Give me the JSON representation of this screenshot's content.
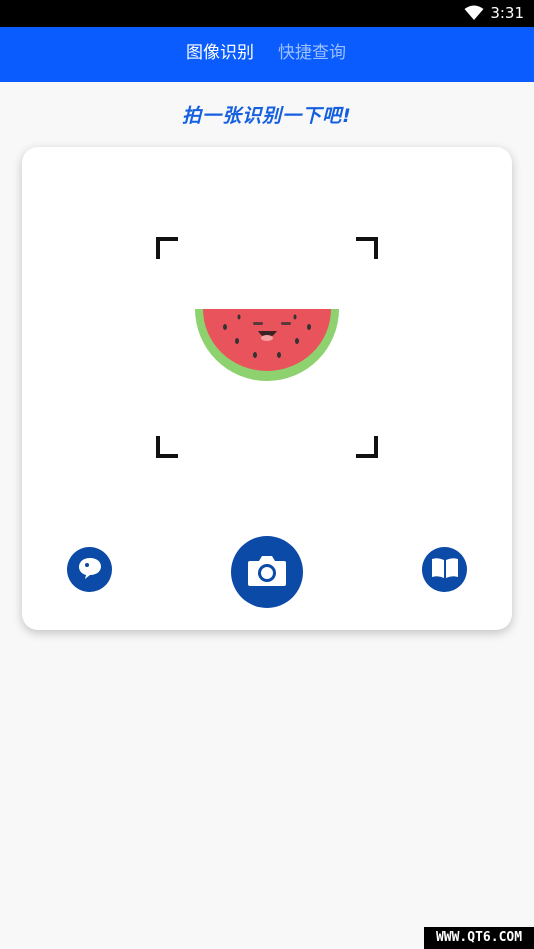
{
  "status_bar": {
    "time": "3:31",
    "wifi_icon": "wifi-icon"
  },
  "header": {
    "tabs": [
      {
        "label": "图像识别",
        "active": true
      },
      {
        "label": "快捷查询",
        "active": false
      }
    ],
    "background_color": "#0a5cff"
  },
  "main": {
    "slogan": "拍一张识别一下吧!",
    "image_icon": "watermelon-illustration",
    "buttons": {
      "chat_icon": "chat-bubble-icon",
      "camera_icon": "camera-icon",
      "book_icon": "open-book-icon"
    },
    "accent_color": "#0b4aa6"
  },
  "watermark": "WWW.QT6.COM"
}
